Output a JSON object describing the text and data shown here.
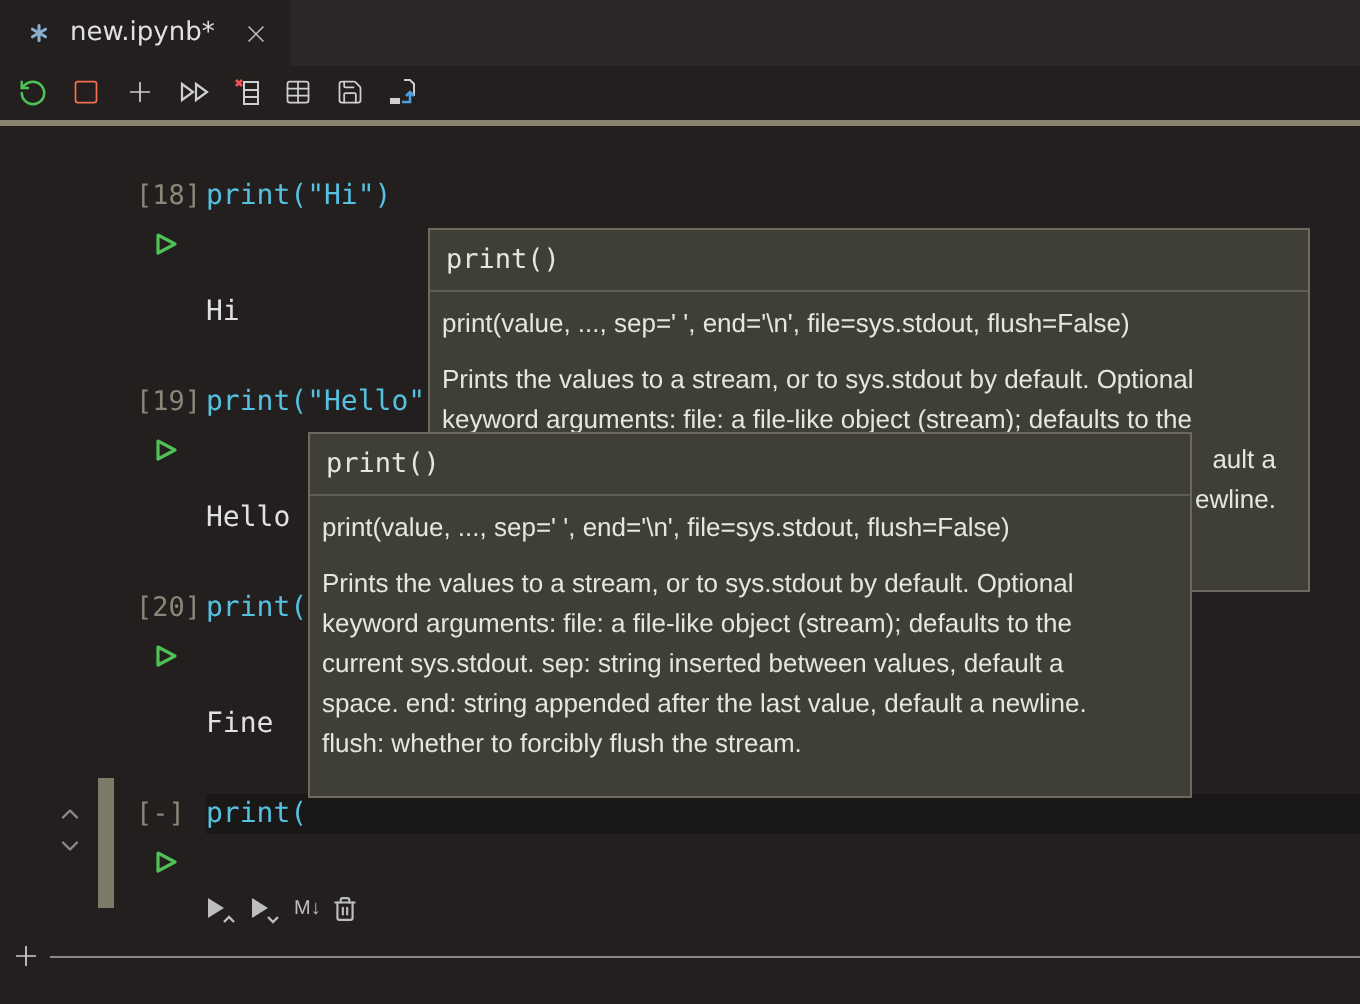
{
  "tab": {
    "title": "new.ipynb*"
  },
  "cells": [
    {
      "prompt": "[18]",
      "code": "print(\"Hi\")",
      "output": "Hi",
      "active": false
    },
    {
      "prompt": "[19]",
      "code": "print(\"Hello\"",
      "output": "Hello",
      "active": false
    },
    {
      "prompt": "[20]",
      "code": "print(",
      "output": "Fine",
      "active": false
    },
    {
      "prompt": "[-]",
      "code": "print(",
      "active": true
    }
  ],
  "cell_toolbar": {
    "markdown_label": "M↓"
  },
  "tooltips": [
    {
      "title": "print()",
      "signature": "print(value, ..., sep=' ', end='\\n', file=sys.stdout, flush=False)",
      "lines": [
        "Prints the values to a stream, or to sys.stdout by default. Optional",
        "keyword arguments: file: a file-like object (stream); defaults to the",
        "ault a",
        "ewline."
      ]
    },
    {
      "title": "print()",
      "signature": "print(value, ..., sep=' ', end='\\n', file=sys.stdout, flush=False)",
      "lines": [
        "Prints the values to a stream, or to sys.stdout by default. Optional",
        "keyword arguments: file: a file-like object (stream); defaults to the",
        "current sys.stdout. sep: string inserted between values, default a",
        "space. end: string appended after the last value, default a newline.",
        "flush: whether to forcibly flush the stream."
      ]
    }
  ]
}
